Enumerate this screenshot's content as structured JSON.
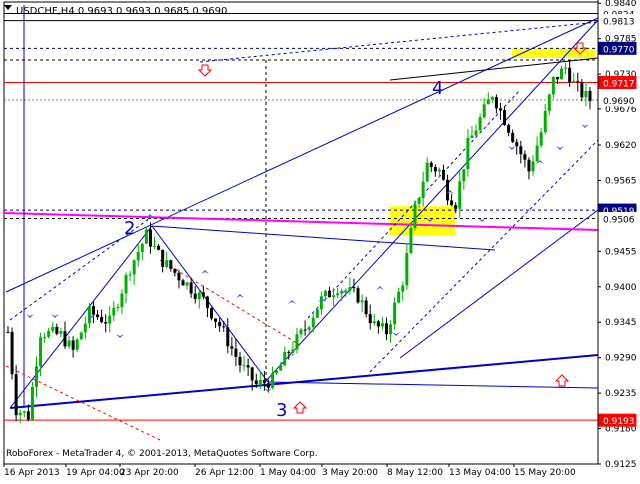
{
  "chart_data": {
    "type": "candlestick",
    "symbol_info": "USDCHF,H4  0.9693 0.9693 0.9685 0.9690",
    "copyright": "RoboForex - MetaTrader 4, © 2001-2013, MetaQuotes Software Corp.",
    "ylim": [
      0.9125,
      0.9845
    ],
    "y_ticks": [
      "0.9840",
      "0.9785",
      "0.9730",
      "0.9676",
      "0.9620",
      "0.9565",
      "0.9510",
      "0.9455",
      "0.9400",
      "0.9345",
      "0.9290",
      "0.9235",
      "0.9180",
      "0.9125"
    ],
    "x_ticks": [
      "16 Apr 2013",
      "19 Apr 04:00",
      "23 Apr 20:00",
      "26 Apr 12:00",
      "1 May 04:00",
      "3 May 20:00",
      "8 May 12:00",
      "13 May 04:00",
      "15 May 20:00"
    ],
    "price_tags": [
      {
        "label": "0.9824",
        "value": 0.9824,
        "style": "black"
      },
      {
        "label": "0.9813",
        "value": 0.9813,
        "style": "black"
      },
      {
        "label": "0.9770",
        "value": 0.977,
        "style": "blue"
      },
      {
        "label": "0.9717",
        "value": 0.9717,
        "style": "red"
      },
      {
        "label": "0.9690",
        "value": 0.969,
        "style": "black"
      },
      {
        "label": "0.9519",
        "value": 0.9519,
        "style": "blue"
      },
      {
        "label": "0.9506",
        "value": 0.9506,
        "style": "black"
      },
      {
        "label": "0.9193",
        "value": 0.9193,
        "style": "red"
      }
    ],
    "wave_labels": [
      "2",
      "3",
      "4"
    ],
    "waypoints": [
      [
        0,
        0.933
      ],
      [
        2,
        0.921
      ],
      [
        5,
        0.92
      ],
      [
        8,
        0.933
      ],
      [
        13,
        0.9325
      ],
      [
        16,
        0.93
      ],
      [
        20,
        0.936
      ],
      [
        25,
        0.9345
      ],
      [
        30,
        0.943
      ],
      [
        34,
        0.948
      ],
      [
        38,
        0.944
      ],
      [
        43,
        0.941
      ],
      [
        48,
        0.938
      ],
      [
        52,
        0.934
      ],
      [
        57,
        0.928
      ],
      [
        61,
        0.9248
      ],
      [
        65,
        0.9255
      ],
      [
        69,
        0.93
      ],
      [
        73,
        0.9335
      ],
      [
        77,
        0.938
      ],
      [
        81,
        0.94
      ],
      [
        86,
        0.9385
      ],
      [
        90,
        0.934
      ],
      [
        93,
        0.933
      ],
      [
        97,
        0.941
      ],
      [
        100,
        0.952
      ],
      [
        103,
        0.959
      ],
      [
        106,
        0.958
      ],
      [
        108,
        0.9545
      ],
      [
        110,
        0.953
      ],
      [
        113,
        0.962
      ],
      [
        116,
        0.966
      ],
      [
        119,
        0.97
      ],
      [
        122,
        0.966
      ],
      [
        125,
        0.962
      ],
      [
        128,
        0.958
      ],
      [
        131,
        0.964
      ],
      [
        134,
        0.972
      ],
      [
        137,
        0.974
      ],
      [
        139,
        0.9715
      ],
      [
        141,
        0.97
      ],
      [
        143,
        0.969
      ]
    ],
    "grid": false,
    "zones": [
      {
        "from": 0.977,
        "to": 0.9755,
        "color": "#ffff00"
      },
      {
        "from": 0.9525,
        "to": 0.948,
        "color": "#ffff00"
      }
    ]
  }
}
